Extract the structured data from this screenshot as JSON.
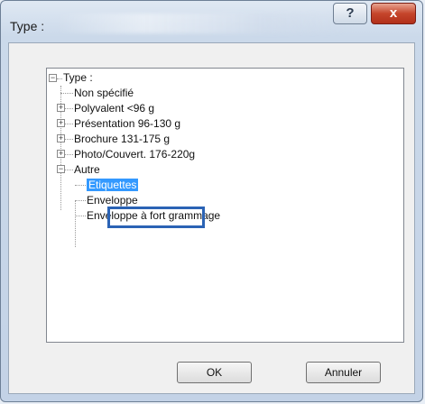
{
  "window": {
    "title": "Type :",
    "help_label": "?",
    "close_label": "x"
  },
  "tree": {
    "root": "Type :",
    "items": [
      {
        "label": "Non spécifié"
      },
      {
        "label": "Polyvalent <96 g"
      },
      {
        "label": "Présentation 96-130 g"
      },
      {
        "label": "Brochure 131-175 g"
      },
      {
        "label": "Photo/Couvert. 176-220g"
      },
      {
        "label": "Autre"
      }
    ],
    "autre_children": [
      {
        "label": "Etiquettes",
        "selected": true
      },
      {
        "label": "Enveloppe"
      },
      {
        "label": "Enveloppe à fort grammage"
      }
    ],
    "collapse_symbol": "−",
    "expand_symbol": "+"
  },
  "buttons": {
    "ok": "OK",
    "cancel": "Annuler"
  },
  "colors": {
    "selection": "#3399ff",
    "highlight_box": "#2b63b5",
    "close_button": "#c5452b"
  }
}
